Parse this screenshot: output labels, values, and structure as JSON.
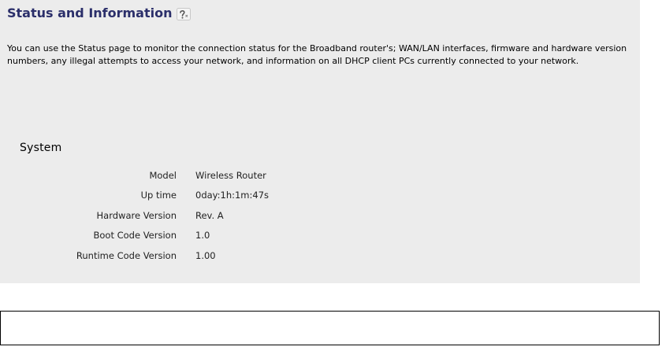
{
  "header": {
    "title": "Status and Information",
    "help_icon": "help-icon"
  },
  "description": "You can use the Status page to monitor the connection status for the Broadband router's; WAN/LAN interfaces, firmware and hardware version numbers, any illegal attempts to access your network, and information on all DHCP client PCs currently connected to your network.",
  "system": {
    "section_title": "System",
    "rows": [
      {
        "label": "Model",
        "value": "Wireless Router"
      },
      {
        "label": "Up time",
        "value": "0day:1h:1m:47s"
      },
      {
        "label": "Hardware Version",
        "value": "Rev. A"
      },
      {
        "label": "Boot Code Version",
        "value": "1.0"
      },
      {
        "label": "Runtime Code Version",
        "value": "1.00"
      }
    ]
  },
  "colors": {
    "panel_background": "#ececec",
    "title_color": "#2b2f6a"
  }
}
